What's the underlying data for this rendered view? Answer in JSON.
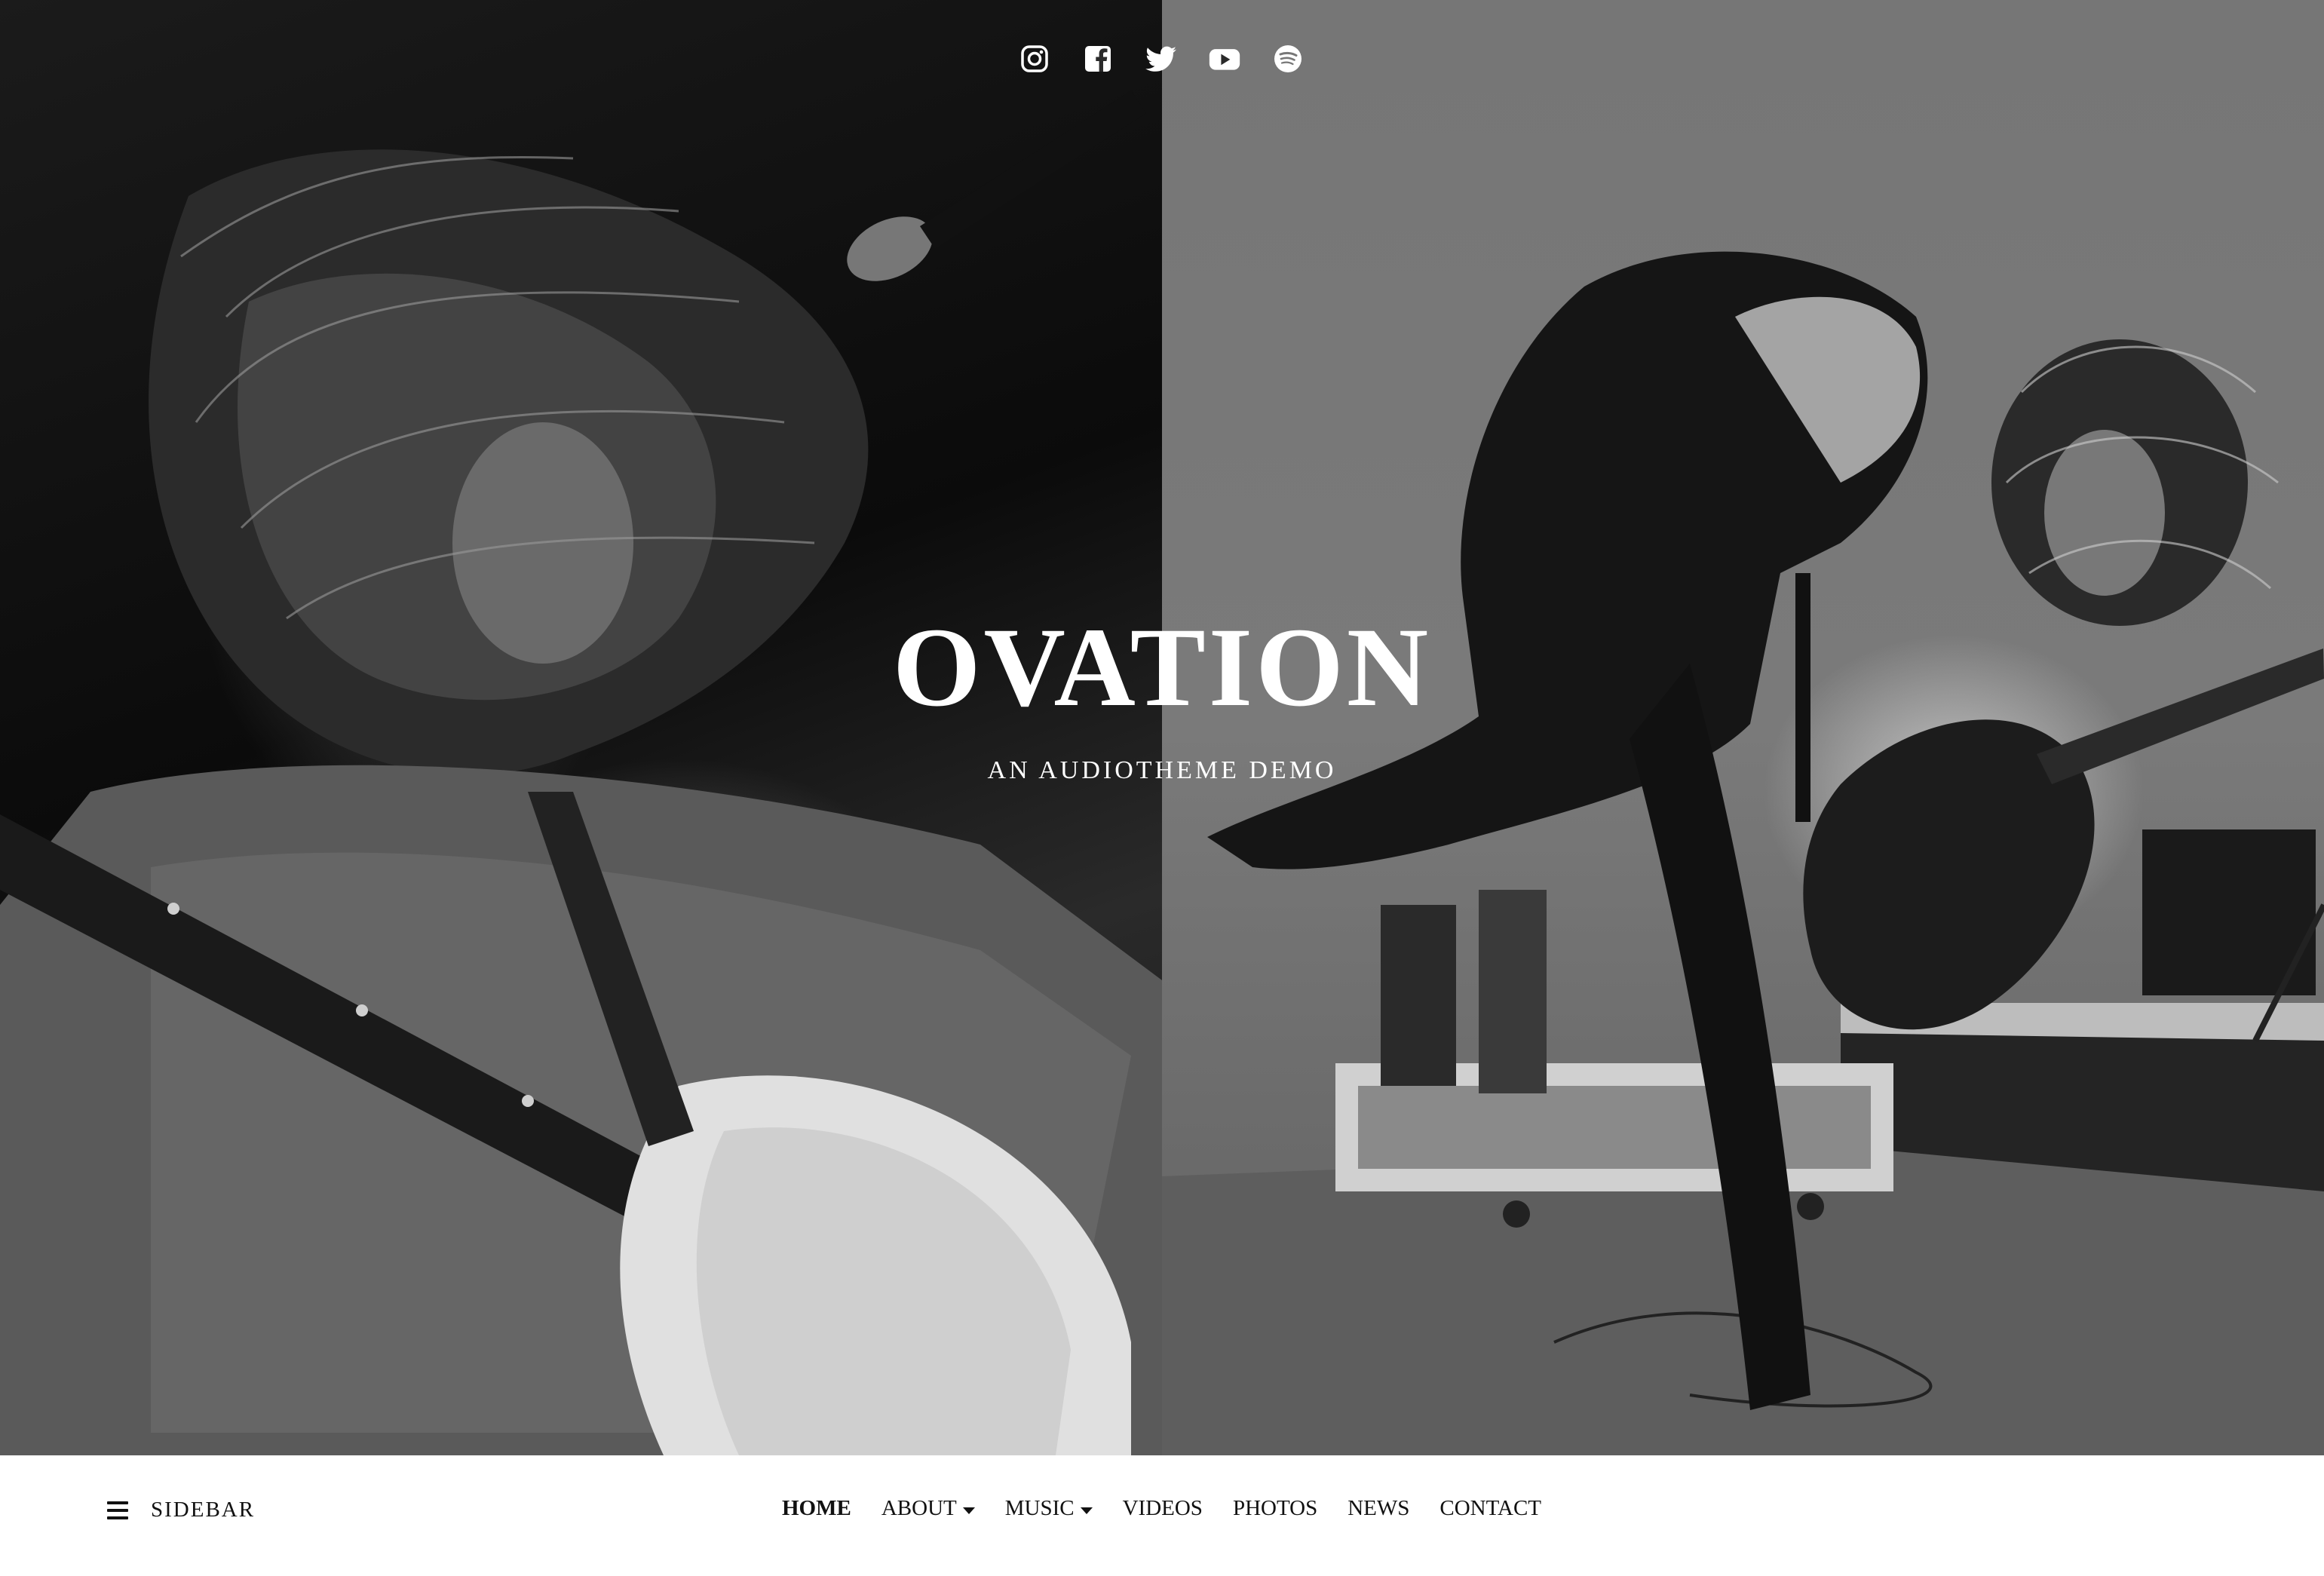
{
  "site": {
    "title": "OVATION",
    "tagline": "AN AUDIOTHEME DEMO"
  },
  "social": [
    {
      "name": "instagram-icon"
    },
    {
      "name": "facebook-icon"
    },
    {
      "name": "twitter-icon"
    },
    {
      "name": "youtube-icon"
    },
    {
      "name": "spotify-icon"
    }
  ],
  "sidebar": {
    "label": "SIDEBAR"
  },
  "nav": {
    "items": [
      {
        "label": "HOME",
        "active": true,
        "dropdown": false
      },
      {
        "label": "ABOUT",
        "active": false,
        "dropdown": true
      },
      {
        "label": "MUSIC",
        "active": false,
        "dropdown": true
      },
      {
        "label": "VIDEOS",
        "active": false,
        "dropdown": false
      },
      {
        "label": "PHOTOS",
        "active": false,
        "dropdown": false
      },
      {
        "label": "NEWS",
        "active": false,
        "dropdown": false
      },
      {
        "label": "CONTACT",
        "active": false,
        "dropdown": false
      }
    ]
  },
  "colors": {
    "text_on_hero": "#ffffff",
    "nav_text": "#111111",
    "nav_background": "#ffffff"
  }
}
